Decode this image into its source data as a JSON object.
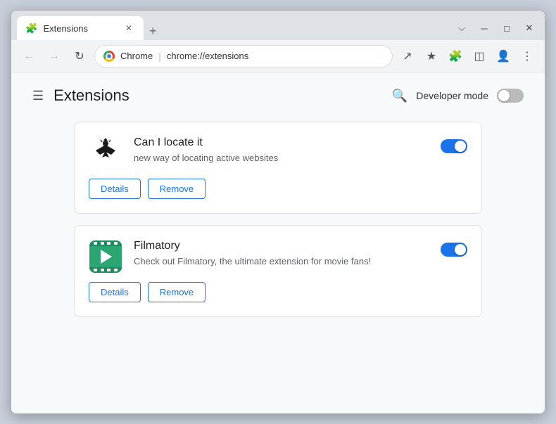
{
  "window": {
    "title": "Extensions",
    "url_chrome": "Chrome",
    "url_path": "chrome://extensions",
    "tab_label": "Extensions",
    "controls": {
      "minimize": "─",
      "maximize": "□",
      "close": "✕",
      "restore_down": "⌵"
    }
  },
  "nav": {
    "back_title": "Back",
    "forward_title": "Forward",
    "reload_title": "Reload"
  },
  "page": {
    "title": "Extensions",
    "developer_mode_label": "Developer mode",
    "developer_mode_on": false
  },
  "extensions": [
    {
      "id": "ext1",
      "name": "Can I locate it",
      "description": "new way of locating active websites",
      "enabled": true,
      "details_label": "Details",
      "remove_label": "Remove"
    },
    {
      "id": "ext2",
      "name": "Filmatory",
      "description": "Check out Filmatory, the ultimate extension for movie fans!",
      "enabled": true,
      "details_label": "Details",
      "remove_label": "Remove"
    }
  ]
}
